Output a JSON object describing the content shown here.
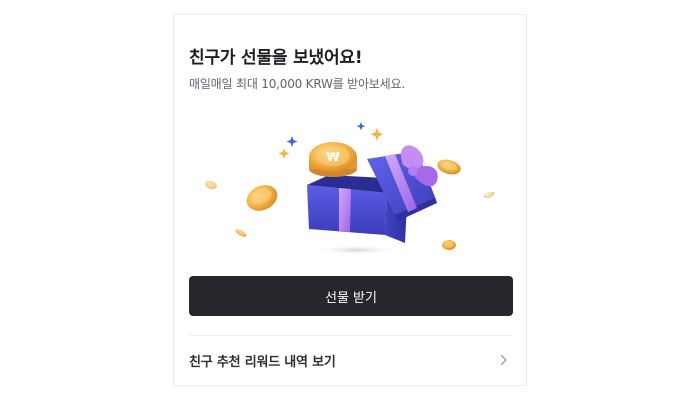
{
  "card": {
    "title": "친구가 선물을 보냈어요!",
    "subtitle": "매일매일 최대 10,000 KRW를 받아보세요.",
    "cta_label": "선물 받기",
    "history_label": "친구 추천 리워드 내역 보기"
  },
  "illustration": {
    "coin_symbol": "₩",
    "icons": [
      "gift-box-icon",
      "coin-icon",
      "sparkle-icon"
    ]
  },
  "colors": {
    "title_text": "#1b1d22",
    "subtitle_text": "#5f6470",
    "button_bg": "#26272b",
    "button_text": "#ffffff",
    "gift_box": "#4b4fd1",
    "ribbon": "#b07ef0",
    "coin": "#f0a83a"
  }
}
